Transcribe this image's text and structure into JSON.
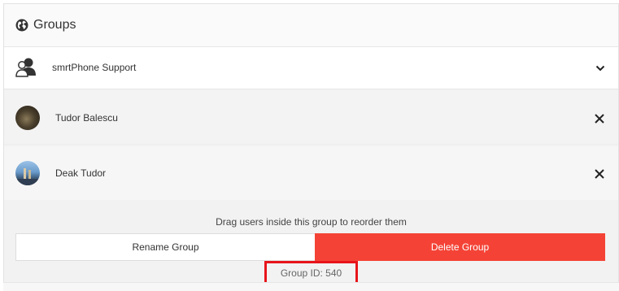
{
  "panel": {
    "title": "Groups",
    "title_icon": "globe-icon"
  },
  "group": {
    "name": "smrtPhone Support",
    "icon": "users-icon",
    "expand_icon": "chevron-down-icon"
  },
  "members": [
    {
      "name": "Tudor Balescu",
      "avatar": "avatar-photo",
      "remove_icon": "close-icon"
    },
    {
      "name": "Deak Tudor",
      "avatar": "avatar-photo",
      "remove_icon": "close-icon"
    }
  ],
  "drag_hint": "Drag users inside this group to reorder them",
  "buttons": {
    "rename": "Rename Group",
    "delete": "Delete Group"
  },
  "group_id_label": "Group ID: 540",
  "colors": {
    "delete_button": "#f44336",
    "highlight_border": "#e8141b",
    "header_background": "#fafafa",
    "members_background": "#f2f2f2"
  }
}
